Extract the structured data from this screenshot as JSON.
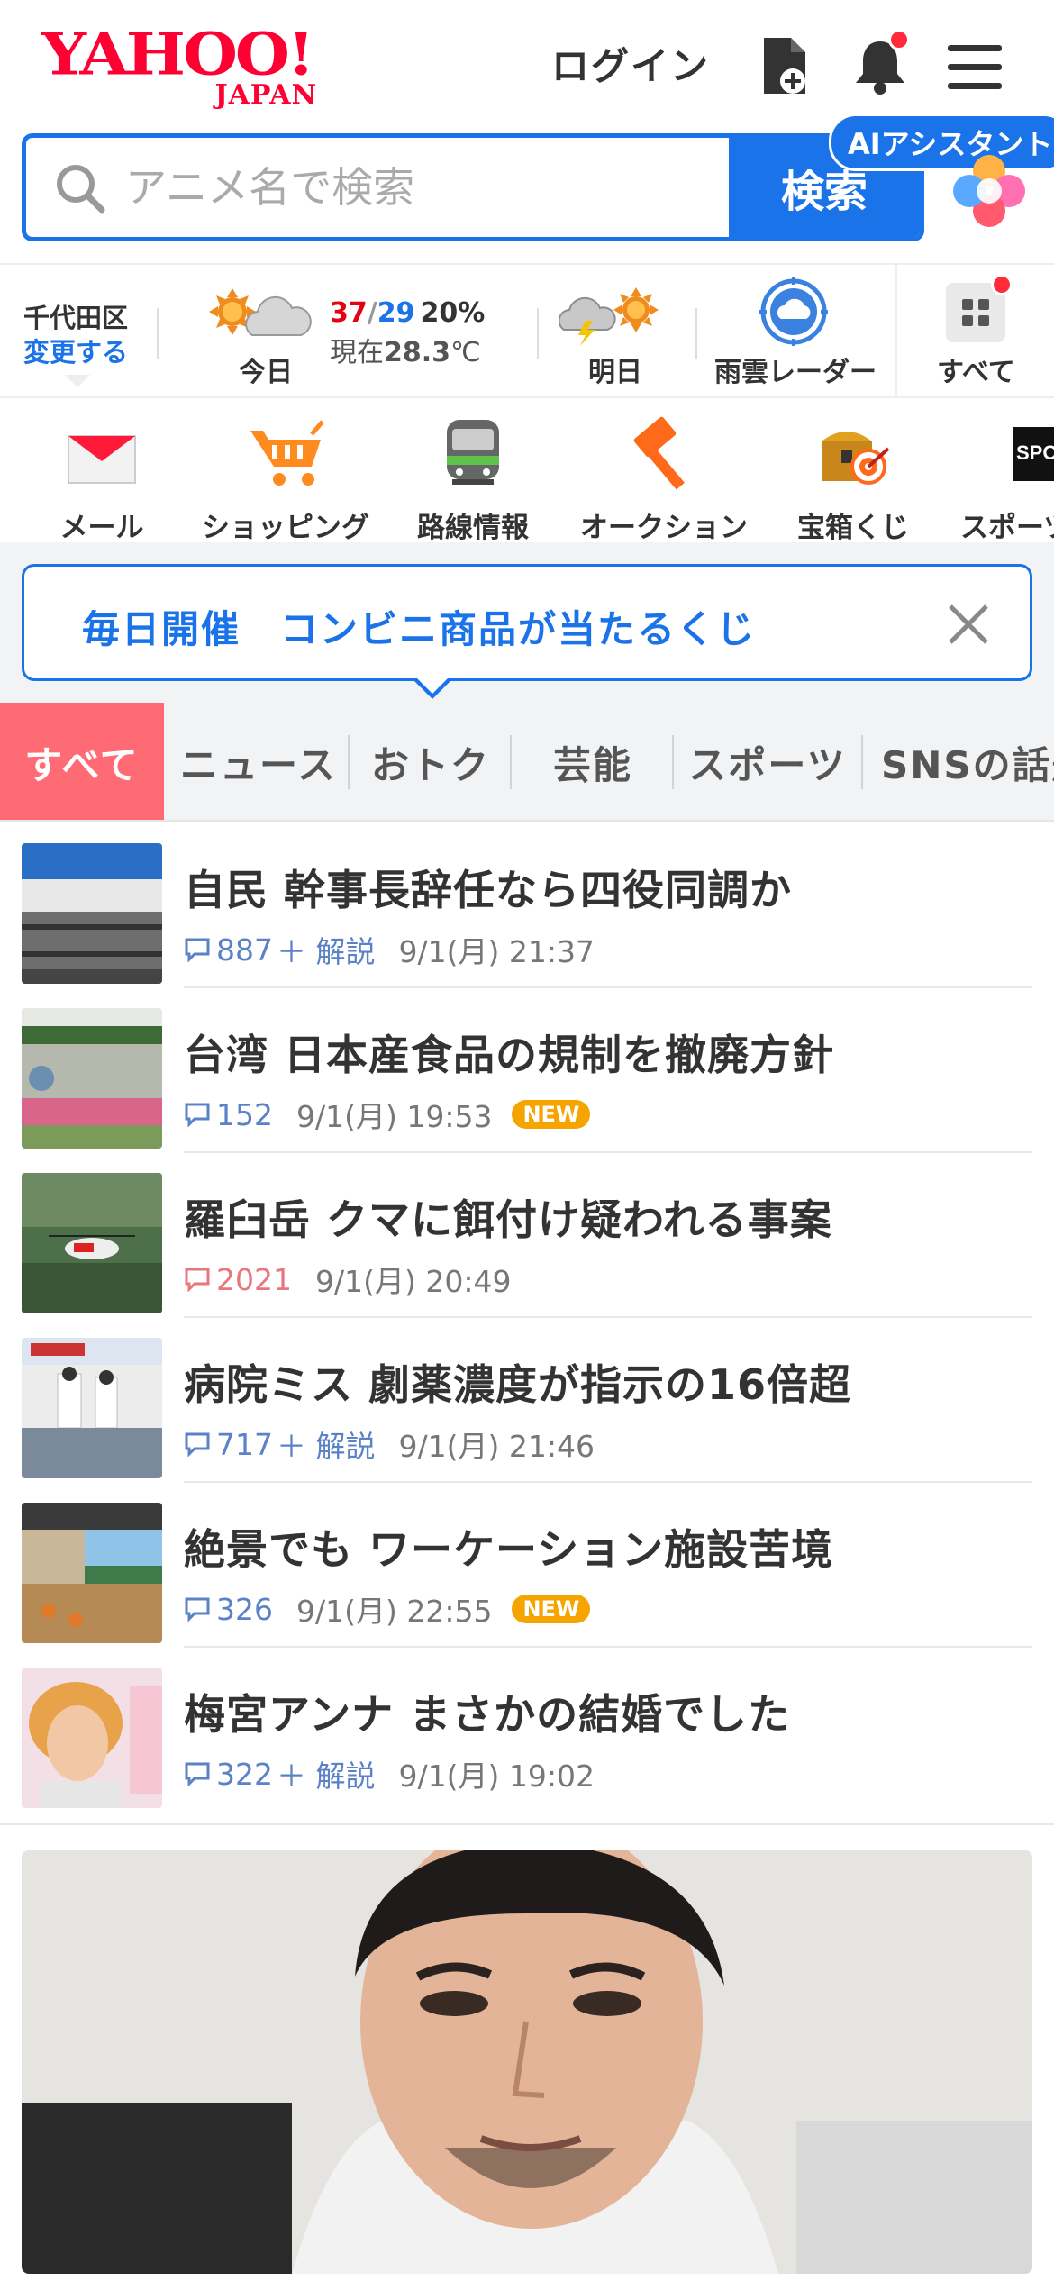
{
  "header": {
    "logo_main": "YAHOO!",
    "logo_sub": "JAPAN",
    "login_label": "ログイン"
  },
  "search": {
    "placeholder": "アニメ名で検索",
    "button_label": "検索",
    "ai_label": "AIアシスタント"
  },
  "weather": {
    "area": "千代田区",
    "change_label": "変更する",
    "today_label": "今日",
    "high": "37",
    "low": "29",
    "rain_pct": "20%",
    "now_prefix": "現在",
    "now_temp": "28.3",
    "now_unit": "℃",
    "tomorrow_label": "明日",
    "radar_label": "雨雲レーダー",
    "all_label": "すべて"
  },
  "services": [
    {
      "label": "メール",
      "icon": "mail-icon"
    },
    {
      "label": "ショッピング",
      "icon": "shopping-cart-icon"
    },
    {
      "label": "路線情報",
      "icon": "train-icon"
    },
    {
      "label": "オークション",
      "icon": "auction-hammer-icon"
    },
    {
      "label": "宝箱くじ",
      "icon": "treasure-box-icon"
    },
    {
      "label": "スポーツ",
      "icon": "sports-icon"
    }
  ],
  "banner": {
    "text": "毎日開催　コンビニ商品が当たるくじ"
  },
  "tabs": [
    "すべて",
    "ニュース",
    "おトク",
    "芸能",
    "スポーツ",
    "SNSの話題"
  ],
  "news": [
    {
      "title": "自民 幹事長辞任なら四役同調か",
      "comments": "887",
      "kaisetsu": "＋ 解説",
      "time": "9/1(月) 21:37",
      "new": "",
      "comment_color": "blue"
    },
    {
      "title": "台湾 日本産食品の規制を撤廃方針",
      "comments": "152",
      "kaisetsu": "",
      "time": "9/1(月) 19:53",
      "new": "NEW",
      "comment_color": "blue"
    },
    {
      "title": "羅臼岳 クマに餌付け疑われる事案",
      "comments": "2021",
      "kaisetsu": "",
      "time": "9/1(月) 20:49",
      "new": "",
      "comment_color": "red"
    },
    {
      "title": "病院ミス 劇薬濃度が指示の16倍超",
      "comments": "717",
      "kaisetsu": "＋ 解説",
      "time": "9/1(月) 21:46",
      "new": "",
      "comment_color": "blue"
    },
    {
      "title": "絶景でも ワーケーション施設苦境",
      "comments": "326",
      "kaisetsu": "",
      "time": "9/1(月) 22:55",
      "new": "NEW",
      "comment_color": "blue"
    },
    {
      "title": "梅宮アンナ まさかの結婚でした",
      "comments": "322",
      "kaisetsu": "＋ 解説",
      "time": "9/1(月) 19:02",
      "new": "",
      "comment_color": "blue"
    }
  ],
  "colors": {
    "brand_red": "#ff0033",
    "accent_blue": "#1a73e8",
    "active_tab": "#ff6b75",
    "new_badge": "#f5a400"
  }
}
